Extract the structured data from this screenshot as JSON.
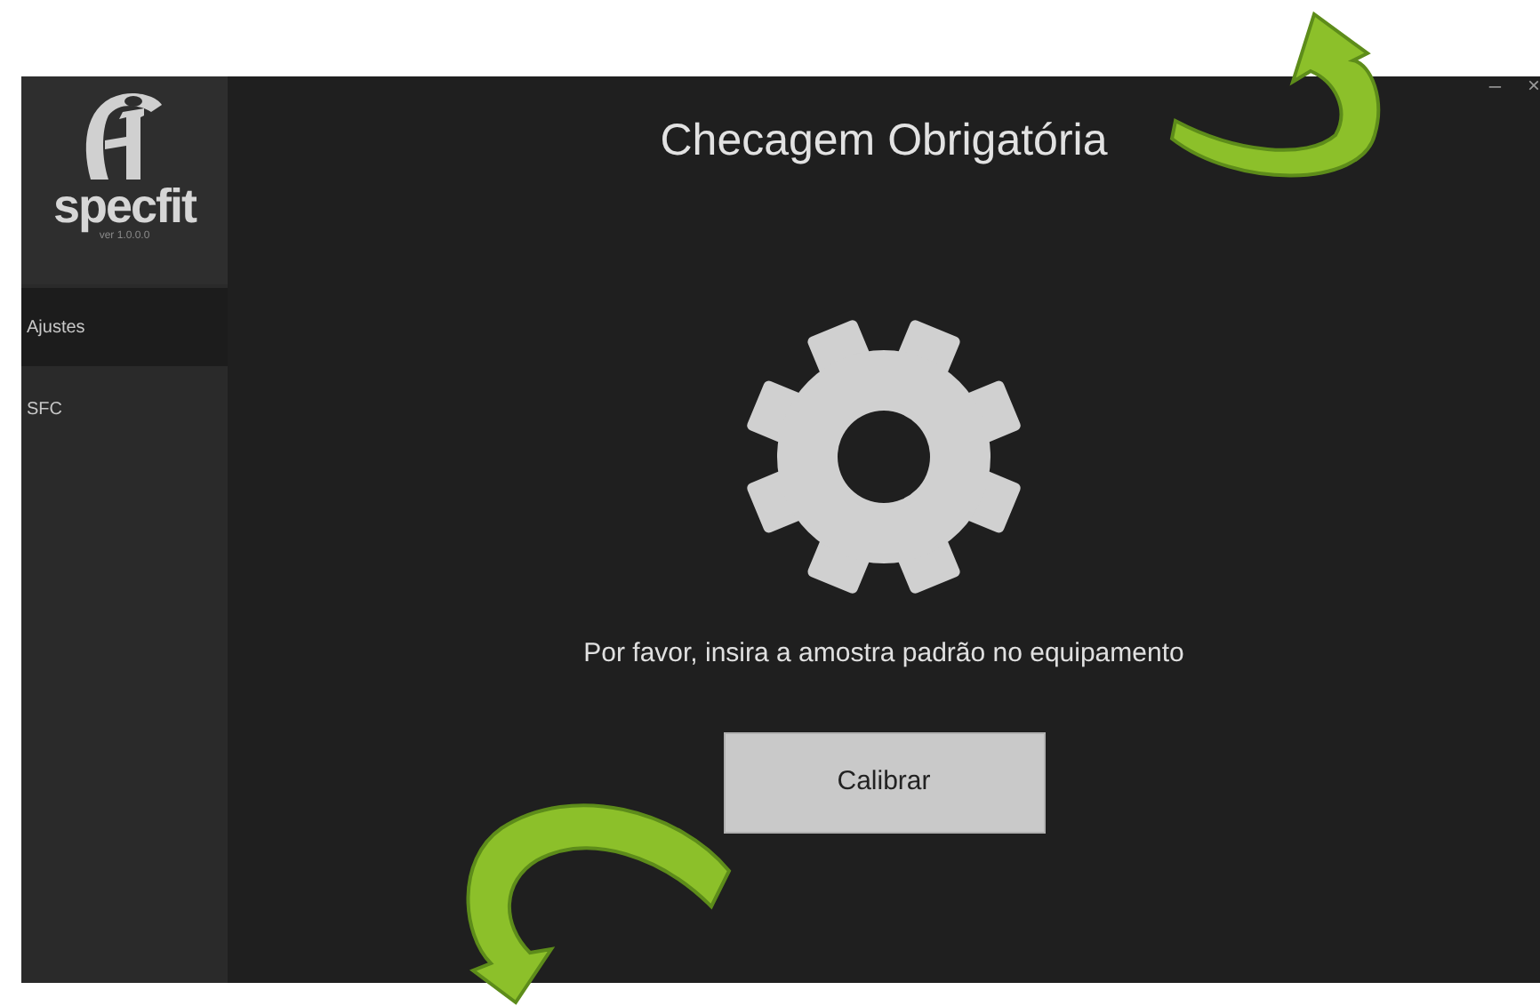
{
  "window": {
    "controls": [
      "–",
      "×"
    ]
  },
  "sidebar": {
    "logo": {
      "wordmark": "specfit",
      "version": "ver 1.0.0.0"
    },
    "items": [
      {
        "label": "Ajustes",
        "selected": true
      },
      {
        "label": "SFC",
        "selected": false
      }
    ]
  },
  "main": {
    "title": "Checagem Obrigatória",
    "message": "Por favor, insira a amostra padrão no equipamento",
    "button": "Calibrar"
  }
}
